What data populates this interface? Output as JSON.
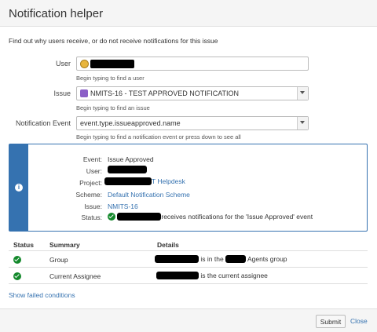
{
  "dialog": {
    "title": "Notification helper",
    "intro": "Find out why users receive, or do not receive notifications for this issue"
  },
  "form": {
    "user": {
      "label": "User",
      "value": "",
      "help": "Begin typing to find a user"
    },
    "issue": {
      "label": "Issue",
      "value": "NMITS-16 - TEST APPROVED NOTIFICATION",
      "help": "Begin typing to find an issue"
    },
    "event": {
      "label": "Notification Event",
      "value": "event.type.issueapproved.name",
      "help": "Begin typing to find a notification event or press down to see all"
    }
  },
  "result": {
    "event_label": "Event:",
    "event_value": "Issue Approved",
    "user_label": "User:",
    "project_label": "Project:",
    "project_value": "T Helpdesk",
    "scheme_label": "Scheme:",
    "scheme_value": "Default Notification Scheme",
    "issue_label": "Issue:",
    "issue_value": "NMITS-16",
    "status_label": "Status:",
    "status_value": "receives notifications for the 'Issue Approved' event"
  },
  "table": {
    "headers": {
      "status": "Status",
      "summary": "Summary",
      "details": "Details"
    },
    "rows": [
      {
        "summary": "Group",
        "details_a": "is in the",
        "details_b": "Agents group"
      },
      {
        "summary": "Current Assignee",
        "details_a": "is the current assignee"
      }
    ]
  },
  "show_failed": "Show failed conditions",
  "footer": {
    "submit": "Submit",
    "close": "Close"
  },
  "colors": {
    "accent": "#3572b0",
    "success": "#14892c"
  }
}
